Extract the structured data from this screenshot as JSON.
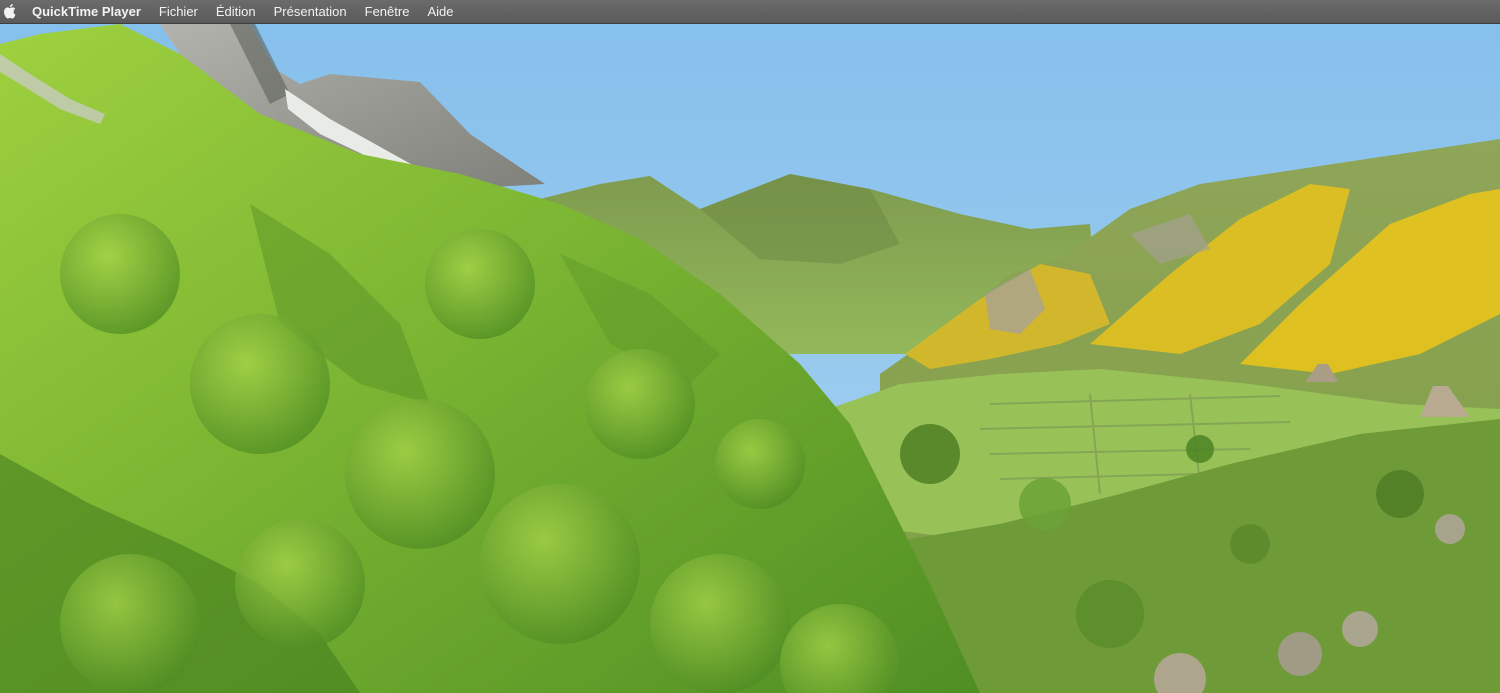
{
  "menubar": {
    "apple_icon": "apple-icon",
    "app_name": "QuickTime Player",
    "items": [
      {
        "label": "Fichier"
      },
      {
        "label": "Édition"
      },
      {
        "label": "Présentation"
      },
      {
        "label": "Fenêtre"
      },
      {
        "label": "Aide"
      }
    ]
  },
  "colors": {
    "sky": "#8ec6ee",
    "forest_light": "#8cc63a",
    "forest_dark": "#3f7a1e",
    "gorse_yellow": "#e6c21f",
    "rock_gray": "#9a9a94",
    "meadow": "#8fbd4e",
    "path_soil": "#c9a07c"
  }
}
